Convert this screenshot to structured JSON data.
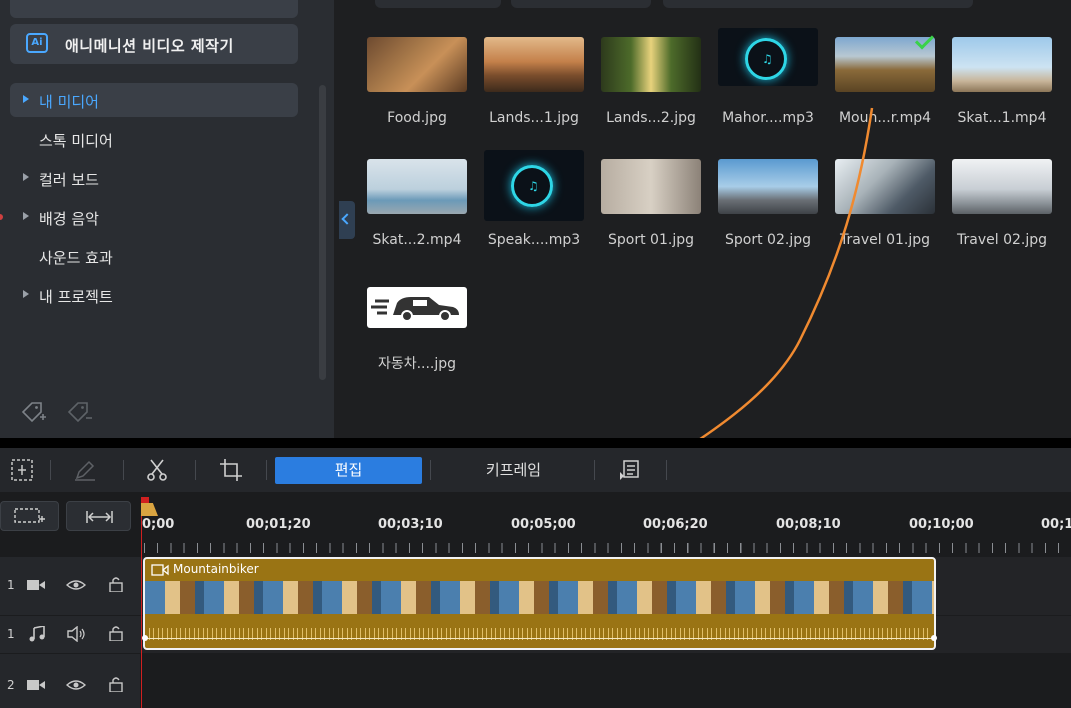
{
  "sidebar": {
    "ai_top_label": "",
    "ai_button_label": "애니메니션 비디오 제작기",
    "items": [
      {
        "label": "내 미디어",
        "selected": true,
        "arrow": true
      },
      {
        "label": "스톡 미디어",
        "selected": false,
        "arrow": false
      },
      {
        "label": "컬러 보드",
        "selected": false,
        "arrow": true
      },
      {
        "label": "배경 음악",
        "selected": false,
        "arrow": true
      },
      {
        "label": "사운드 효과",
        "selected": false,
        "arrow": false
      },
      {
        "label": "내 프로젝트",
        "selected": false,
        "arrow": true
      }
    ],
    "icons": [
      "add-tag-icon",
      "remove-tag-icon"
    ]
  },
  "media": {
    "items": [
      {
        "label": "Food.jpg",
        "thumb": "food"
      },
      {
        "label": "Lands...1.jpg",
        "thumb": "land1"
      },
      {
        "label": "Lands...2.jpg",
        "thumb": "land2"
      },
      {
        "label": "Mahor....mp3",
        "thumb": "music"
      },
      {
        "label": "Moun...r.mp4",
        "thumb": "mtn",
        "checked": true
      },
      {
        "label": "Skat...1.mp4",
        "thumb": "skate1"
      },
      {
        "label": "Skat...2.mp4",
        "thumb": "skate2"
      },
      {
        "label": "Speak....mp3",
        "thumb": "music"
      },
      {
        "label": "Sport 01.jpg",
        "thumb": "sport1"
      },
      {
        "label": "Sport 02.jpg",
        "thumb": "sport2"
      },
      {
        "label": "Travel 01.jpg",
        "thumb": "trav1"
      },
      {
        "label": "Travel 02.jpg",
        "thumb": "trav2"
      },
      {
        "label": "자동차....jpg",
        "thumb": "car"
      }
    ]
  },
  "toolbar": {
    "tab_edit": "편집",
    "tab_keyframe": "키프레임",
    "icons": [
      "snapshot-icon",
      "pen-icon",
      "scissors-icon",
      "crop-icon",
      "properties-icon"
    ]
  },
  "timeline": {
    "ruler": [
      "0;00",
      "00;01;20",
      "00;03;10",
      "00;05;00",
      "00;06;20",
      "00;08;10",
      "00;10;00",
      "00;1"
    ],
    "tracks": [
      {
        "number": "1",
        "type": "video"
      },
      {
        "number": "1",
        "type": "audio"
      },
      {
        "number": "2",
        "type": "video"
      }
    ],
    "clip_title": "Mountainbiker"
  },
  "colors": {
    "accent": "#2b7de0",
    "clip": "#9a7414",
    "arrow_annotation": "#f08a30",
    "playhead": "#d02020"
  }
}
